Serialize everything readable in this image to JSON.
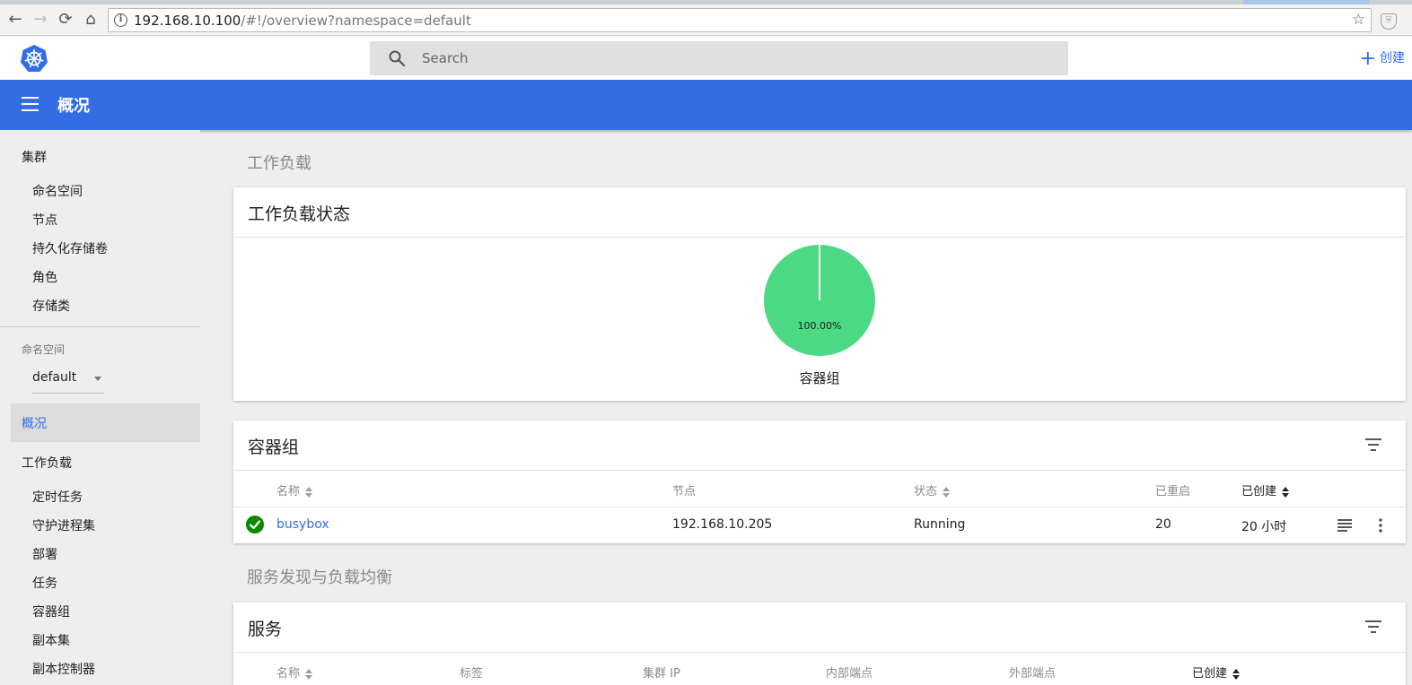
{
  "browser": {
    "url_host": "192.168.10.100",
    "url_path": "/#!/overview?namespace=default",
    "back_icon": "←",
    "forward_icon": "→",
    "reload_icon": "⟳",
    "home_icon": "⌂",
    "info_icon": "i",
    "star_icon": "☆",
    "ext_icon": "⛨"
  },
  "toolbar": {
    "search_placeholder": "Search",
    "create_icon": "+",
    "create_label": "创建"
  },
  "header": {
    "title": "概况"
  },
  "sidebar": {
    "cluster_label": "集群",
    "cluster_items": [
      "命名空间",
      "节点",
      "持久化存储卷",
      "角色",
      "存储类"
    ],
    "namespace_label": "命名空间",
    "namespace_value": "default",
    "overview_label": "概况",
    "workloads_label": "工作负载",
    "workload_items": [
      "定时任务",
      "守护进程集",
      "部署",
      "任务",
      "容器组",
      "副本集",
      "副本控制器"
    ]
  },
  "main": {
    "workloads_section": "工作负载",
    "status_card": {
      "title": "工作负载状态",
      "pie_percent": "100.00%",
      "pie_label": "容器组",
      "pie_color": "#4cd984"
    },
    "pods_card": {
      "title": "容器组",
      "columns": [
        "名称",
        "节点",
        "状态",
        "已重启",
        "已创建"
      ],
      "rows": [
        {
          "name": "busybox",
          "node": "192.168.10.205",
          "status": "Running",
          "restarts": "20",
          "created": "20 小时"
        }
      ]
    },
    "discovery_section": "服务发现与负载均衡",
    "services_card": {
      "title": "服务",
      "columns": [
        "名称",
        "标签",
        "集群 IP",
        "内部端点",
        "外部端点",
        "已创建"
      ]
    }
  },
  "colors": {
    "brand": "#326de6",
    "success": "#0a8a00",
    "pie": "#4cd984"
  }
}
